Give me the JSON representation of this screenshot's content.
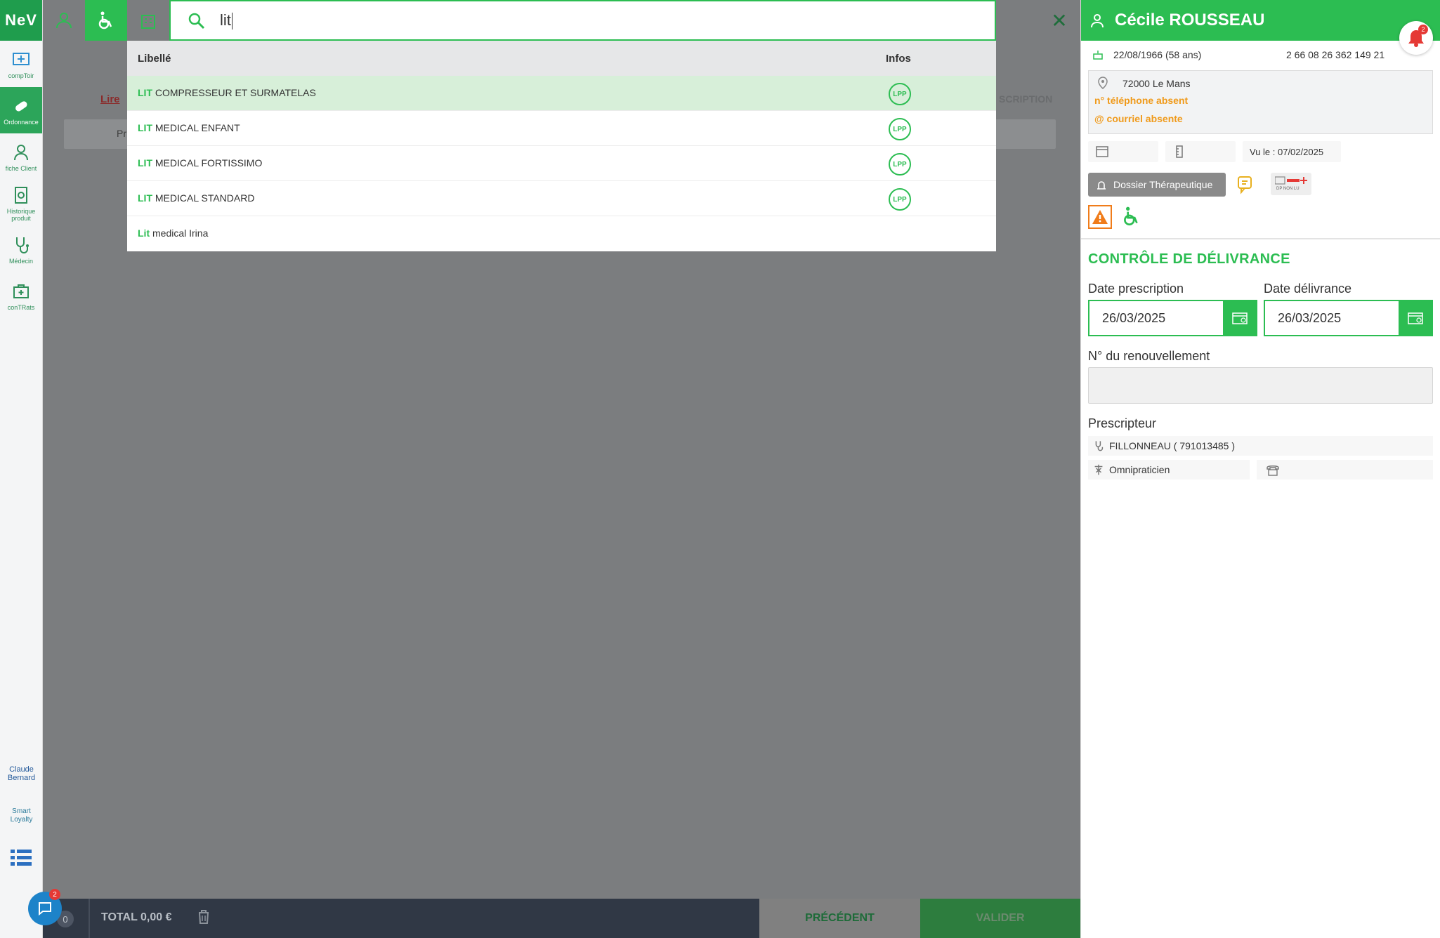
{
  "sidebar": {
    "logo": "NeV",
    "items": [
      {
        "label": "compToir"
      },
      {
        "label": "Ordonnance"
      },
      {
        "label": "fiche Client"
      },
      {
        "label": "Historique produit"
      },
      {
        "label": "Médecin"
      },
      {
        "label": "conTRats"
      }
    ],
    "brand1": "Claude Bernard",
    "brand2": "Smart Loyalty"
  },
  "search": {
    "query": "lit"
  },
  "results": {
    "headers": {
      "libelle": "Libellé",
      "infos": "Infos"
    },
    "rows": [
      {
        "prefix": "LIT",
        "rest": " COMPRESSEUR ET SURMATELAS",
        "badge": "LPP"
      },
      {
        "prefix": "LIT",
        "rest": " MEDICAL ENFANT",
        "badge": "LPP"
      },
      {
        "prefix": "LIT",
        "rest": " MEDICAL FORTISSIMO",
        "badge": "LPP"
      },
      {
        "prefix": "LIT",
        "rest": " MEDICAL STANDARD",
        "badge": "LPP"
      },
      {
        "prefix": "Lit",
        "rest": " medical Irina",
        "badge": ""
      }
    ]
  },
  "background": {
    "link": "Lire",
    "right": "SCRIPTION",
    "bar": "Pr"
  },
  "bottom": {
    "count": "0",
    "total": "TOTAL 0,00 €",
    "prev": "PRÉCÉDENT",
    "validate": "VALIDER",
    "chat_badge": "2"
  },
  "patient": {
    "name": "Cécile ROUSSEAU",
    "bell_badge": "2",
    "birth": "22/08/1966 (58 ans)",
    "nir": "2 66 08 26 362 149 21",
    "city": "72000 Le Mans",
    "no_phone": "n° téléphone absent",
    "no_email": "@ courriel absente",
    "seen": "Vu le : 07/02/2025",
    "dossier": "Dossier Thérapeutique",
    "dp_label": "DP NON LU"
  },
  "control": {
    "title": "CONTRÔLE DE DÉLIVRANCE",
    "date_presc_label": "Date prescription",
    "date_presc": "26/03/2025",
    "date_deliv_label": "Date délivrance",
    "date_deliv": "26/03/2025",
    "renew_label": "N° du renouvellement",
    "prescriber_label": "Prescripteur",
    "prescriber": "FILLONNEAU ( 791013485 )",
    "speciality": "Omnipraticien"
  },
  "colors": {
    "accent": "#2cbd52",
    "warning": "#f09a1a",
    "bottom_bar": "#303845"
  }
}
